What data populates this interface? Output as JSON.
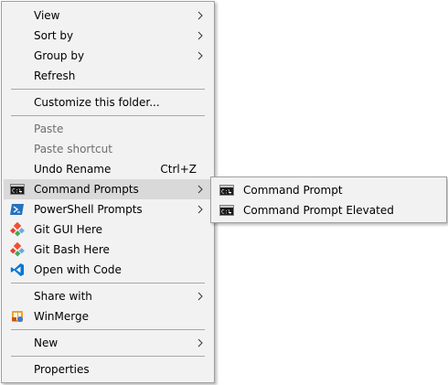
{
  "context_menu": {
    "items": [
      {
        "label": "View",
        "submenu": true
      },
      {
        "label": "Sort by",
        "submenu": true
      },
      {
        "label": "Group by",
        "submenu": true
      },
      {
        "label": "Refresh"
      },
      {
        "label": "Customize this folder..."
      },
      {
        "label": "Paste",
        "disabled": true
      },
      {
        "label": "Paste shortcut",
        "disabled": true
      },
      {
        "label": "Undo Rename",
        "shortcut": "Ctrl+Z"
      },
      {
        "label": "Command Prompts",
        "submenu": true,
        "icon": "cmd-icon",
        "highlighted": true
      },
      {
        "label": "PowerShell Prompts",
        "submenu": true,
        "icon": "powershell-icon"
      },
      {
        "label": "Git GUI Here",
        "icon": "git-icon"
      },
      {
        "label": "Git Bash Here",
        "icon": "git-icon"
      },
      {
        "label": "Open with Code",
        "icon": "vscode-icon"
      },
      {
        "label": "Share with",
        "submenu": true
      },
      {
        "label": "WinMerge",
        "icon": "winmerge-icon"
      },
      {
        "label": "New",
        "submenu": true
      },
      {
        "label": "Properties"
      }
    ]
  },
  "submenu": {
    "items": [
      {
        "label": "Command Prompt",
        "icon": "cmd-icon"
      },
      {
        "label": "Command Prompt Elevated",
        "icon": "cmd-icon"
      }
    ]
  },
  "colors": {
    "menu_background": "#f2f2f2",
    "menu_border": "#a0a0a0",
    "highlight": "#d9d9d9",
    "disabled_text": "#6d6d6d",
    "separator": "#a8a8a8"
  }
}
